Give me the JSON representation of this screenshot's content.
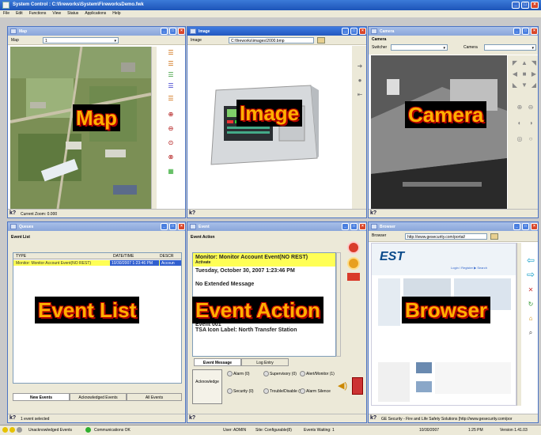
{
  "app": {
    "title": "System Control : C:\\fireworks\\System\\FireworksDemo.fwk",
    "menu": [
      "File",
      "Edit",
      "Functions",
      "View",
      "Status",
      "Applications",
      "Help"
    ]
  },
  "map": {
    "title": "Map",
    "layer_label": "Map",
    "layer_value": "1",
    "zoom_status": "Current Zoom: 0.000",
    "overlay": "Map"
  },
  "image": {
    "title": "Image",
    "path_label": "Image",
    "path_value": "C:\\fireworks\\images\\2000.bmp",
    "overlay": "Image"
  },
  "camera": {
    "title": "Camera",
    "section_label": "Camera",
    "switcher_label": "Switcher",
    "camera_label": "Camera",
    "overlay": "Camera"
  },
  "queues": {
    "title": "Queues",
    "section_label": "Event List",
    "columns": [
      "TYPE",
      "DATE/TIME",
      "DESCR"
    ],
    "row": {
      "type": "Monitor: Monitor Account Event(NO REST)",
      "datetime": "10/30/2007 1:23:46 PM",
      "descr": "Accoun"
    },
    "tabs": [
      "New Events",
      "Acknowledged Events",
      "All Events"
    ],
    "status": "1 event selected",
    "overlay": "Event List"
  },
  "event": {
    "title": "Event",
    "section_label": "Event Action",
    "alert": "Monitor: Monitor Account Event(NO REST)",
    "alert2": "Activate",
    "date_line": "Tuesday, October 30, 2007 1:23:46 PM",
    "extended": "No Extended Message",
    "event_id": "Event 001",
    "tsa_label": "TSA Icon Label: North Transfer Station",
    "tabs": [
      "Event Message",
      "Log Entry"
    ],
    "ack_button": "Acknowledge",
    "counters": [
      {
        "name": "Alarm",
        "count": "(0)"
      },
      {
        "name": "Supervisory",
        "count": "(0)"
      },
      {
        "name": "Alert/Monitor",
        "count": "(1)"
      },
      {
        "name": "Security",
        "count": "(0)"
      },
      {
        "name": "Trouble/Disable",
        "count": "(0)"
      },
      {
        "name": "Alarm Silence",
        "count": ""
      }
    ],
    "overlay": "Event Action"
  },
  "browser": {
    "title": "Browser",
    "address_label": "Browser",
    "address_value": "http://www.gesecurity.com/portal/",
    "logo": "EST",
    "login": "Login / Register  ▶ Search",
    "status": "GE Security - Fire and Life Safety Solutions [http://www.gesecurity.com/por",
    "overlay": "Browser"
  },
  "statusbar": {
    "unack": "Unacknowledged Events",
    "comm": "Communications OK",
    "user": "User: ADMIN",
    "site": "Site: Configurable(8)",
    "waiting": "Events Waiting: 1",
    "date": "10/30/2007",
    "time": "1:25 PM",
    "version": "Version 1.41.03"
  },
  "colors": {
    "title_blue": "#2358c0",
    "overlay_text": "#ffb000",
    "alert_yellow": "#ffff55",
    "selection_blue": "#315fcf"
  }
}
